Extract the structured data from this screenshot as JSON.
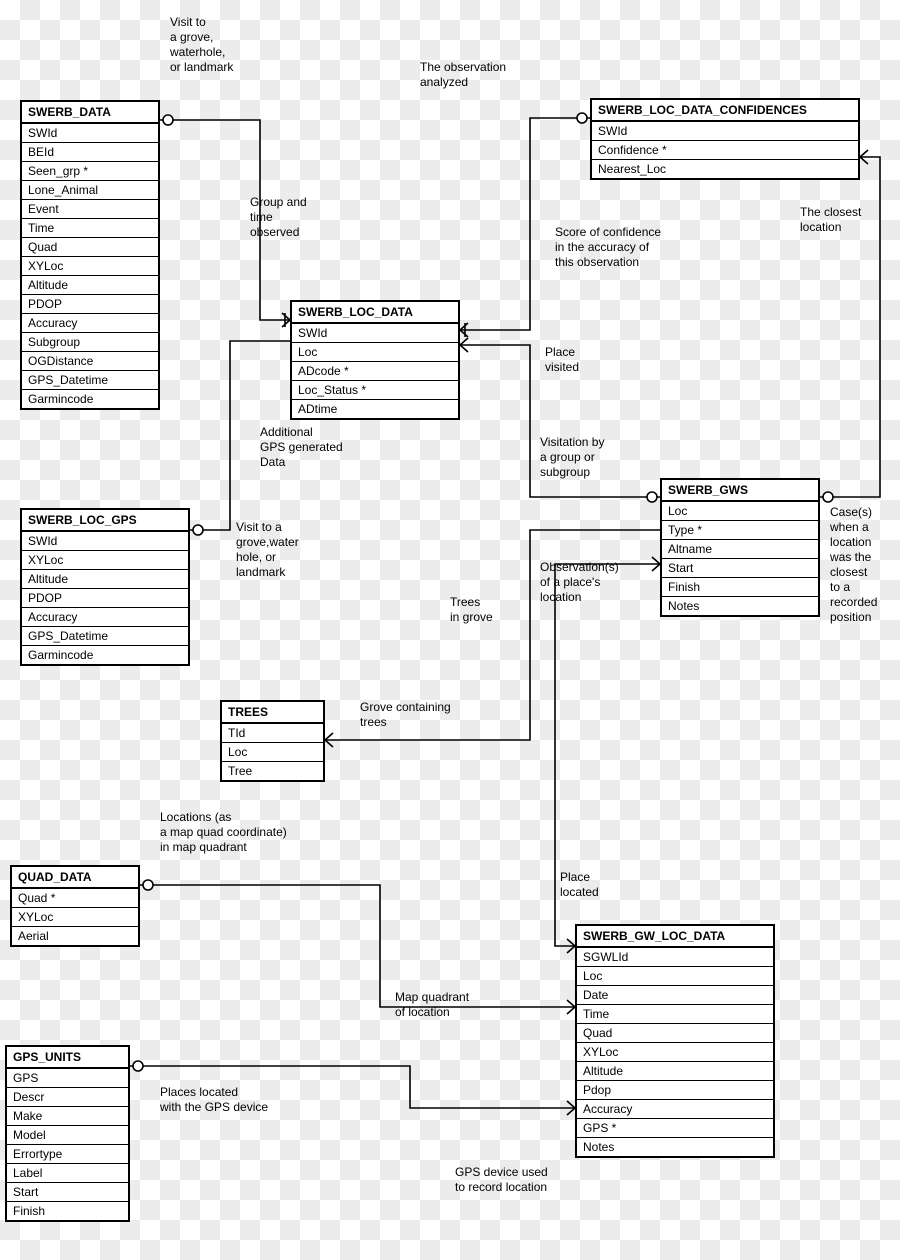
{
  "entities": {
    "swerb_data": {
      "title": "SWERB_DATA",
      "attrs": [
        "SWId",
        "BEId",
        "Seen_grp *",
        "Lone_Animal",
        "Event",
        "Time",
        "Quad",
        "XYLoc",
        "Altitude",
        "PDOP",
        "Accuracy",
        "Subgroup",
        "OGDistance",
        "GPS_Datetime",
        "Garmincode"
      ]
    },
    "swerb_loc_gps": {
      "title": "SWERB_LOC_GPS",
      "attrs": [
        "SWId",
        "XYLoc",
        "Altitude",
        "PDOP",
        "Accuracy",
        "GPS_Datetime",
        "Garmincode"
      ]
    },
    "swerb_loc_data": {
      "title": "SWERB_LOC_DATA",
      "attrs": [
        "SWId",
        "Loc",
        "ADcode *",
        "Loc_Status *",
        "ADtime"
      ]
    },
    "swerb_loc_data_confidences": {
      "title": "SWERB_LOC_DATA_CONFIDENCES",
      "attrs": [
        "SWId",
        "Confidence *",
        "Nearest_Loc"
      ]
    },
    "swerb_gws": {
      "title": "SWERB_GWS",
      "attrs": [
        "Loc",
        "Type *",
        "Altname",
        "Start",
        "Finish",
        "Notes"
      ]
    },
    "trees": {
      "title": "TREES",
      "attrs": [
        "TId",
        "Loc",
        "Tree"
      ]
    },
    "quad_data": {
      "title": "QUAD_DATA",
      "attrs": [
        "Quad *",
        "XYLoc",
        "Aerial"
      ]
    },
    "swerb_gw_loc_data": {
      "title": "SWERB_GW_LOC_DATA",
      "attrs": [
        "SGWLId",
        "Loc",
        "Date",
        "Time",
        "Quad",
        "XYLoc",
        "Altitude",
        "Pdop",
        "Accuracy",
        "GPS *",
        "Notes"
      ]
    },
    "gps_units": {
      "title": "GPS_UNITS",
      "attrs": [
        "GPS",
        "Descr",
        "Make",
        "Model",
        "Errortype",
        "Label",
        "Start",
        "Finish"
      ]
    }
  },
  "labels": {
    "visit_grove": "Visit to\na grove,\nwaterhole,\nor landmark",
    "obs_analyzed": "The observation\nanalyzed",
    "group_time": "Group and\ntime\nobserved",
    "score_conf": "Score of confidence\nin the accuracy of\nthis observation",
    "closest_loc": "The closest\nlocation",
    "place_visited": "Place\nvisited",
    "visitation": "Visitation by\na group or\nsubgroup",
    "additional_gps": "Additional\nGPS generated\nData",
    "visit_grove2": "Visit to a\ngrove,water\nhole, or\nlandmark",
    "obs_place_loc": "Observation(s)\nof a place's\nlocation",
    "trees_in_grove": "Trees\nin grove",
    "cases_loc": "Case(s)\nwhen a\nlocation\nwas the\nclosest\nto a\nrecorded\nposition",
    "grove_containing": "Grove containing\ntrees",
    "locations_quad": "Locations (as\na map quad coordinate)\nin map quadrant",
    "place_located": "Place\nlocated",
    "map_quad_loc": "Map quadrant\nof location",
    "places_gps": "Places located\nwith the GPS device",
    "gps_device": "GPS device used\nto record location"
  }
}
